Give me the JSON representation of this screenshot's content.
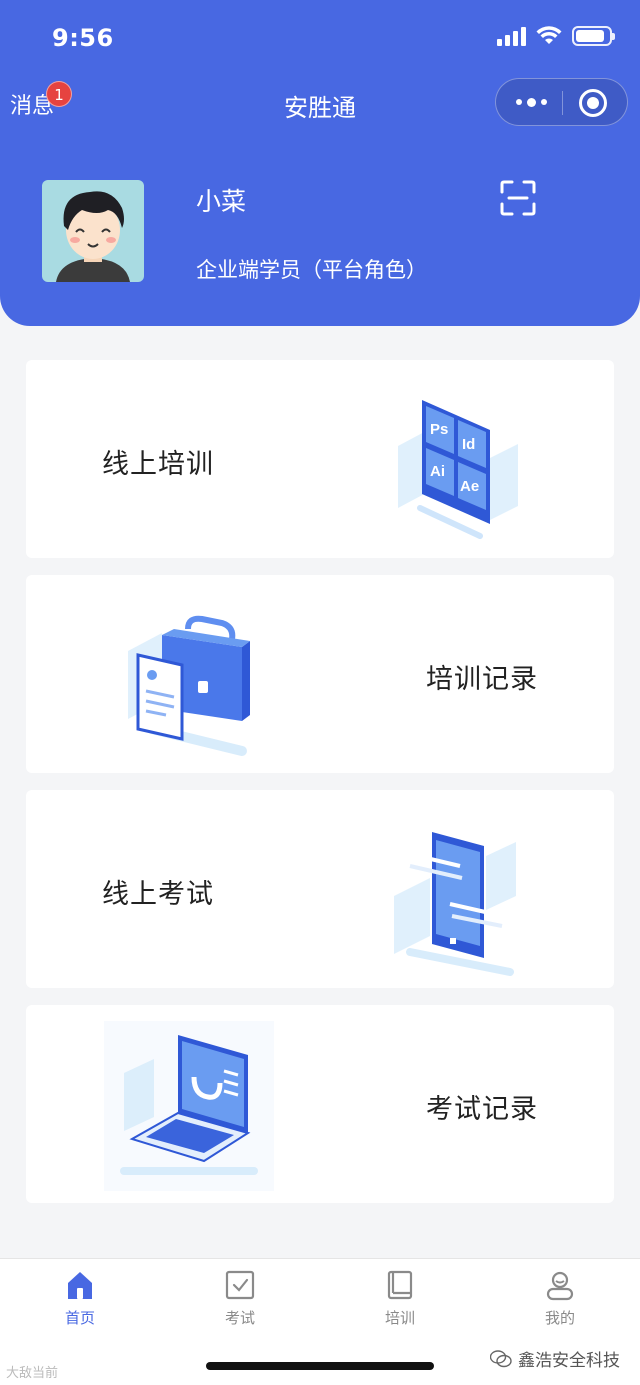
{
  "status_bar": {
    "time": "9:56"
  },
  "navbar": {
    "messages_label": "消息",
    "messages_badge": "1",
    "title": "安胜通"
  },
  "profile": {
    "name": "小菜",
    "role": "企业端学员（平台角色）"
  },
  "cards": [
    {
      "label": "线上培训",
      "icon": "design-apps-icon"
    },
    {
      "label": "培训记录",
      "icon": "briefcase-document-icon"
    },
    {
      "label": "线上考试",
      "icon": "tablet-exam-icon"
    },
    {
      "label": "考试记录",
      "icon": "laptop-record-icon"
    }
  ],
  "tabbar": {
    "items": [
      {
        "label": "首页",
        "icon": "home-icon",
        "active": true
      },
      {
        "label": "考试",
        "icon": "exam-checklist-icon",
        "active": false
      },
      {
        "label": "培训",
        "icon": "book-icon",
        "active": false
      },
      {
        "label": "我的",
        "icon": "user-icon",
        "active": false
      }
    ]
  },
  "watermark": {
    "left": "大敌当前",
    "right": "鑫浩安全科技"
  },
  "colors": {
    "brand": "#4868e2",
    "badge": "#e64340",
    "background": "#f4f5f7"
  }
}
